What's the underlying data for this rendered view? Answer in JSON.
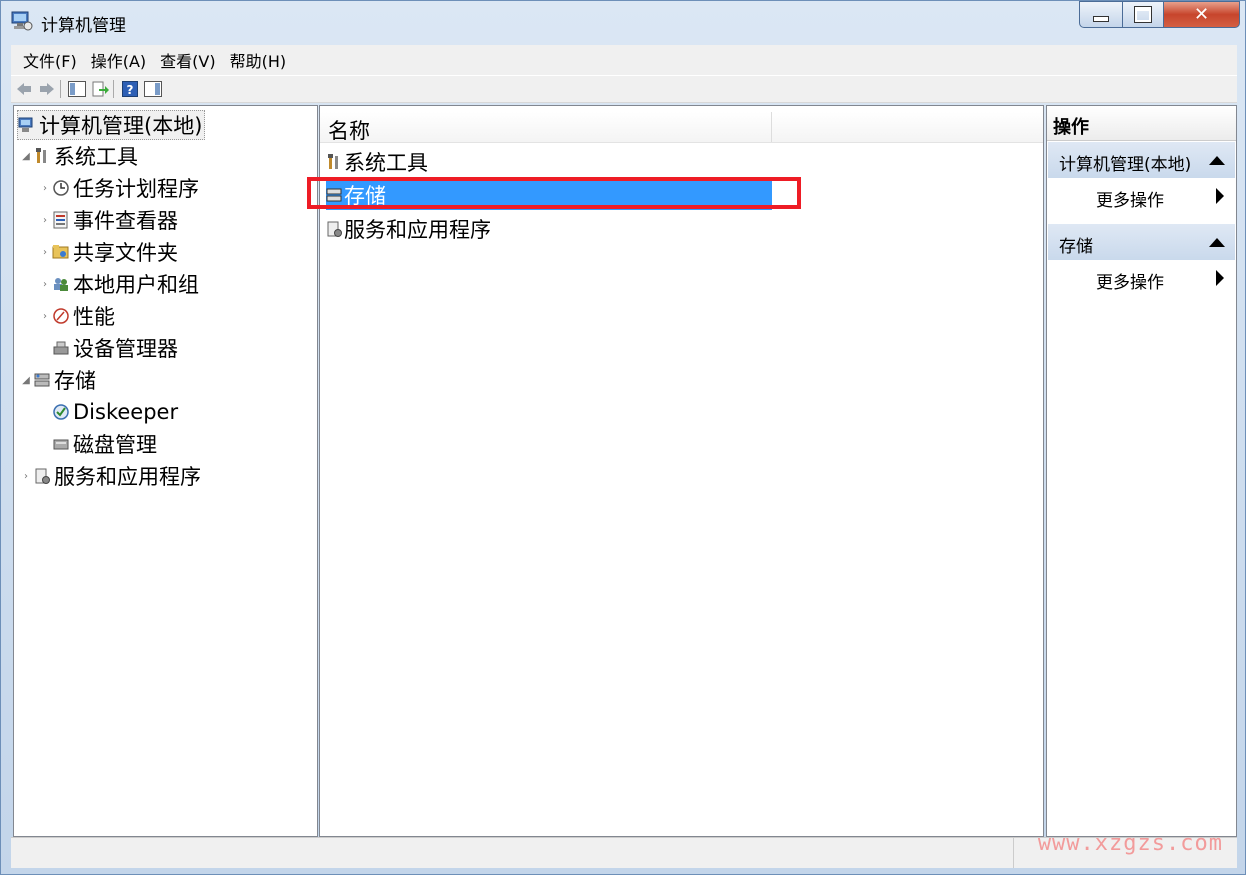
{
  "window": {
    "title": "计算机管理"
  },
  "menubar": {
    "items": [
      "文件(F)",
      "操作(A)",
      "查看(V)",
      "帮助(H)"
    ]
  },
  "toolbar": {
    "buttons": [
      "back-icon",
      "forward-icon",
      "show-tree-icon",
      "export-icon",
      "help-icon",
      "show-action-pane-icon"
    ]
  },
  "tree": {
    "root": "计算机管理(本地)",
    "system_tools": "系统工具",
    "task_scheduler": "任务计划程序",
    "event_viewer": "事件查看器",
    "shared_folders": "共享文件夹",
    "local_users": "本地用户和组",
    "performance": "性能",
    "device_manager": "设备管理器",
    "storage": "存储",
    "diskeeper": "Diskeeper",
    "disk_management": "磁盘管理",
    "services_apps": "服务和应用程序"
  },
  "center": {
    "column_name": "名称",
    "rows": [
      "系统工具",
      "存储",
      "服务和应用程序"
    ],
    "selected_row": "存储"
  },
  "actions": {
    "title": "操作",
    "sections": [
      {
        "title": "计算机管理(本地)",
        "item": "更多操作"
      },
      {
        "title": "存储",
        "item": "更多操作"
      }
    ]
  },
  "watermark": "www.xzgzs.com",
  "colors": {
    "selection": "#3399ff",
    "highlight_box": "#ee1c25",
    "action_section": "#d3e0f0"
  }
}
